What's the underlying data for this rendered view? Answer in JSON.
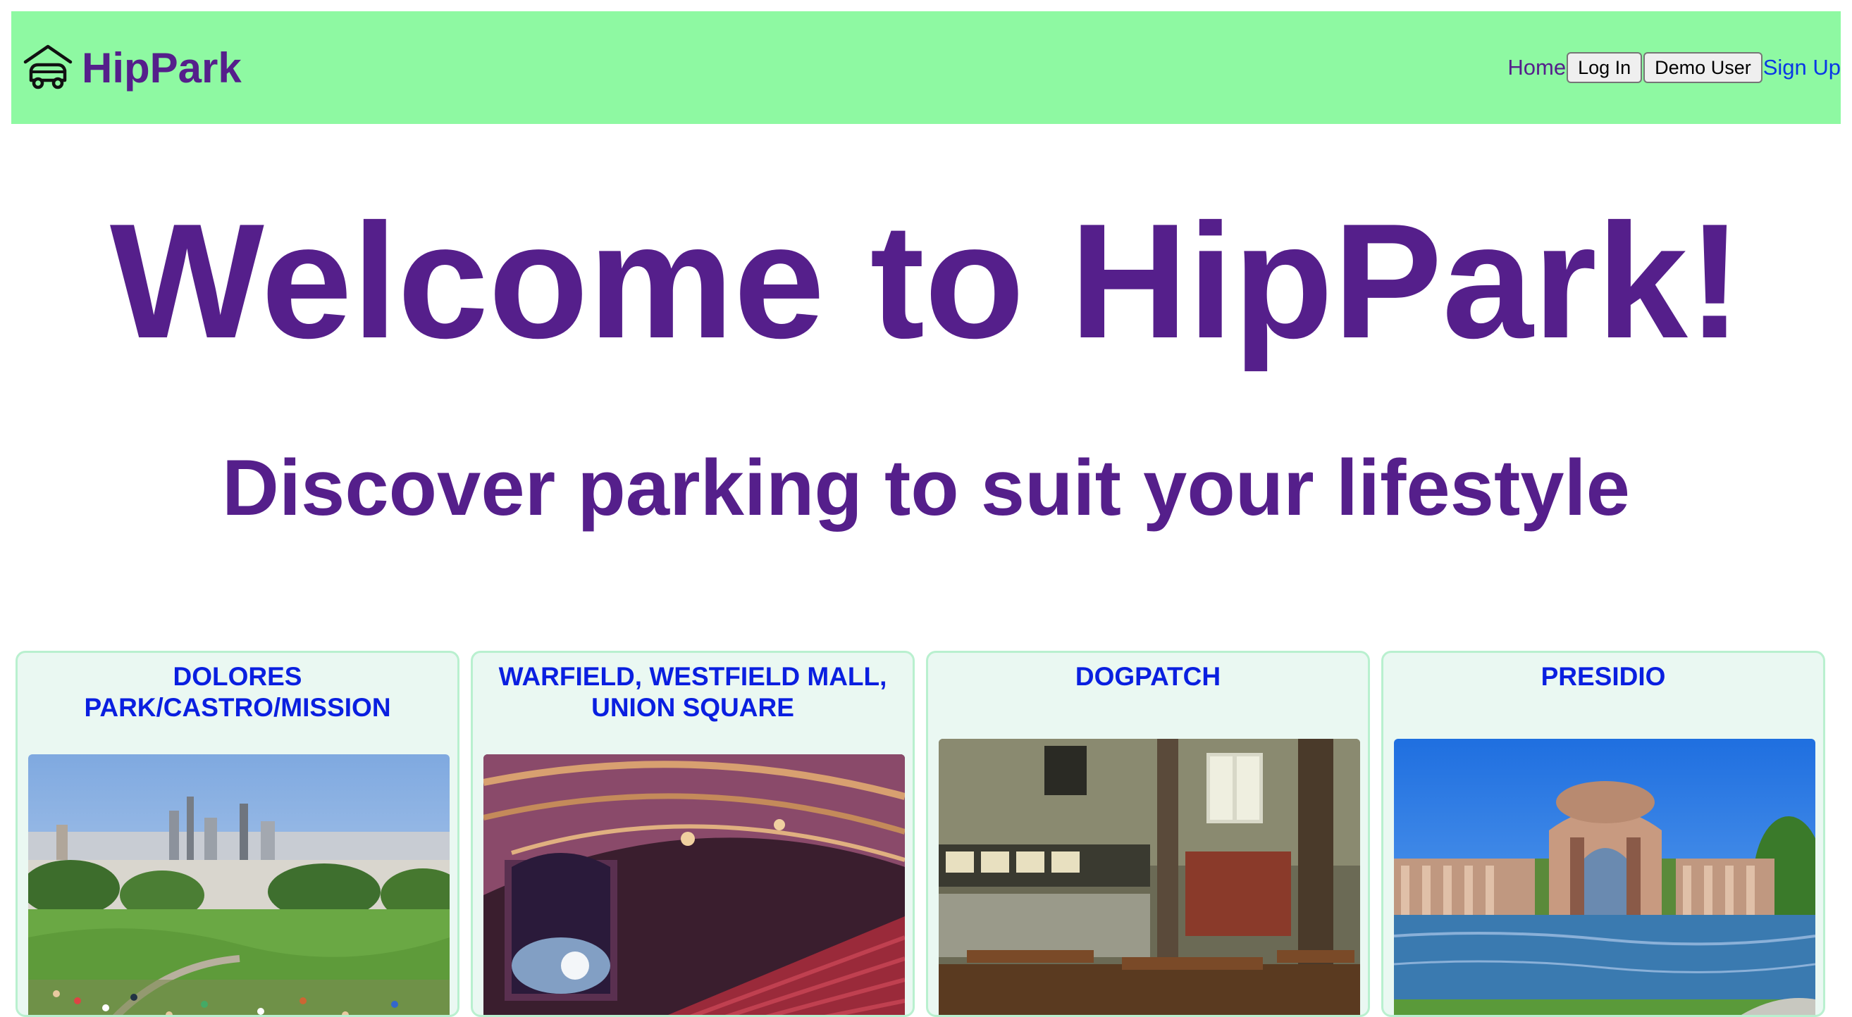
{
  "navbar": {
    "brand_icon": "car-house-icon",
    "brand_name": "HipPark",
    "home_label": "Home",
    "login_label": "Log In",
    "demo_label": "Demo User",
    "signup_label": "Sign Up"
  },
  "hero": {
    "title": "Welcome to HipPark!",
    "subtitle": "Discover parking to suit your lifestyle"
  },
  "cards": [
    {
      "title": "DOLORES PARK/CASTRO/MISSION",
      "image": "dolores-park-photo"
    },
    {
      "title": "WARFIELD, WESTFIELD MALL, UNION SQUARE",
      "image": "warfield-theater-photo"
    },
    {
      "title": "DOGPATCH",
      "image": "dogpatch-restaurant-photo"
    },
    {
      "title": "PRESIDIO",
      "image": "palace-of-fine-arts-photo"
    }
  ],
  "colors": {
    "navbar_bg": "#8ef9a2",
    "brand_purple": "#551f8b",
    "link_blue": "#0a37e6",
    "card_title_blue": "#0a1fe0",
    "card_bg": "#eaf8f2"
  }
}
